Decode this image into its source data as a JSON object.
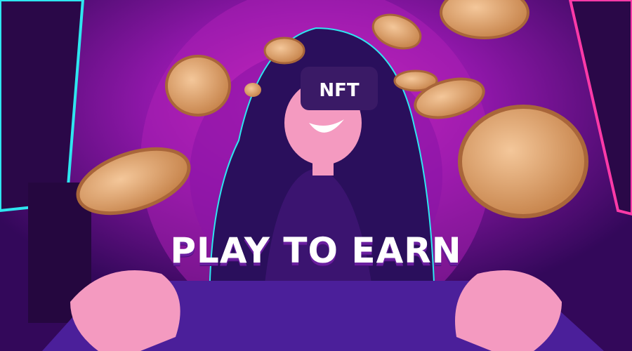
{
  "visor_text": "NFT",
  "headline": "PLAY TO EARN",
  "colors": {
    "background": "#3a0a5e",
    "glow": "#c21fb8",
    "neon_left": "#2ee6f0",
    "neon_right": "#ff3aa8",
    "coin": "#e0a36a",
    "skin": "#f49ac0",
    "hair": "#2a0f5c"
  }
}
